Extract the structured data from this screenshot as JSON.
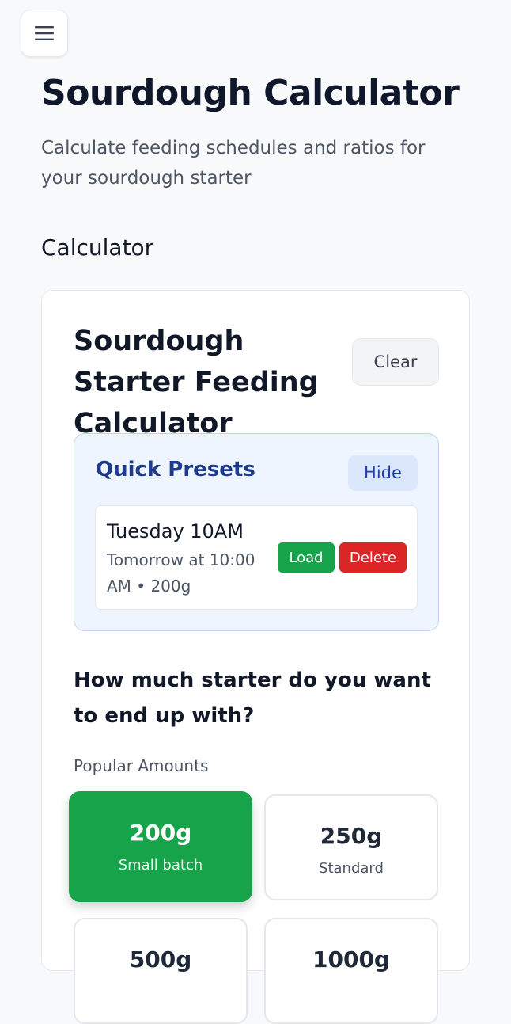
{
  "header": {
    "menu_icon": "hamburger-menu-icon",
    "title": "Sourdough Calculator",
    "subtitle": "Calculate feeding schedules and ratios for your sourdough starter"
  },
  "section": {
    "heading": "Calculator"
  },
  "calculator": {
    "title": "Sourdough Starter Feeding Calculator",
    "clear_label": "Clear",
    "presets": {
      "title": "Quick Presets",
      "hide_label": "Hide",
      "items": [
        {
          "name": "Tuesday 10AM",
          "detail": "Tomorrow at 10:00 AM • 200g",
          "load_label": "Load",
          "delete_label": "Delete"
        }
      ]
    },
    "question": "How much starter do you want to end up with?",
    "popular_label": "Popular Amounts",
    "amounts": [
      {
        "value": "200g",
        "label": "Small batch",
        "selected": true
      },
      {
        "value": "250g",
        "label": "Standard",
        "selected": false
      },
      {
        "value": "500g",
        "label": "",
        "selected": false
      },
      {
        "value": "1000g",
        "label": "",
        "selected": false
      }
    ]
  },
  "colors": {
    "accent_green": "#16a34a",
    "danger_red": "#dc2626",
    "preset_bg": "#eef5ff",
    "preset_title": "#1e3a8a"
  }
}
